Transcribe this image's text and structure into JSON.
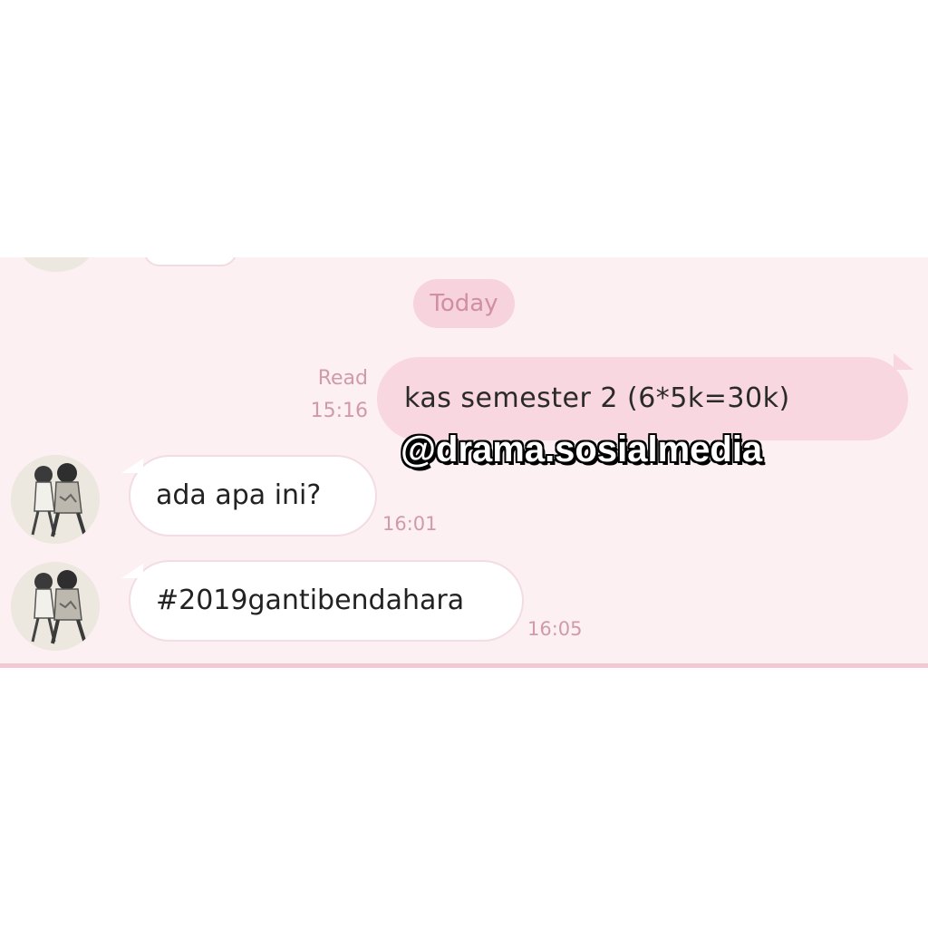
{
  "chat": {
    "date_separator": "Today",
    "messages": [
      {
        "direction": "outgoing",
        "text": "kas semester 2 (6*5k=30k)",
        "status": "Read",
        "time": "15:16"
      },
      {
        "direction": "incoming",
        "text": "ada apa ini?",
        "time": "16:01",
        "avatar": "couple-avatar-icon"
      },
      {
        "direction": "incoming",
        "text": "#2019gantibendahara",
        "time": "16:05",
        "avatar": "couple-avatar-icon"
      }
    ]
  },
  "watermark": "@drama.sosialmedia",
  "colors": {
    "chat_background": "#fcf0f3",
    "outgoing_bubble": "#f8d7e0",
    "incoming_bubble": "#ffffff",
    "meta_text": "#d09aab",
    "divider": "#f2c9d3"
  }
}
